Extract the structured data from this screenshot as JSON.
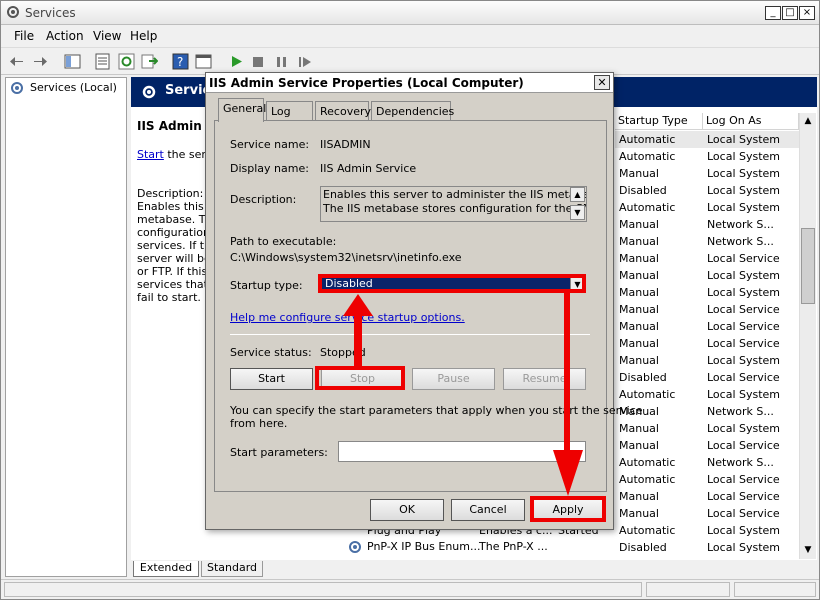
{
  "window": {
    "title": "Services"
  },
  "menu": [
    "File",
    "Action",
    "View",
    "Help"
  ],
  "tree": {
    "root": "Services (Local)"
  },
  "panel": {
    "header": "Service",
    "service_title": "IIS Admin Se",
    "start_link": "Start",
    "start_rest": " the servi",
    "description_label": "Description:",
    "description_lines": [
      "Enables this se",
      "metabase. The",
      "configuration f",
      "services. If thi",
      "server will be u",
      "or FTP. If this",
      "services that e",
      "fail to start."
    ]
  },
  "list": {
    "columns": [
      "Startup Type",
      "Log On As"
    ],
    "rows": [
      [
        "Automatic",
        "Local System"
      ],
      [
        "Automatic",
        "Local System"
      ],
      [
        "Manual",
        "Local System"
      ],
      [
        "Disabled",
        "Local System"
      ],
      [
        "Automatic",
        "Local System"
      ],
      [
        "Manual",
        "Network S..."
      ],
      [
        "Manual",
        "Network S..."
      ],
      [
        "Manual",
        "Local Service"
      ],
      [
        "Manual",
        "Local System"
      ],
      [
        "Manual",
        "Local System"
      ],
      [
        "Manual",
        "Local Service"
      ],
      [
        "Manual",
        "Local Service"
      ],
      [
        "Manual",
        "Local Service"
      ],
      [
        "Manual",
        "Local System"
      ],
      [
        "Disabled",
        "Local Service"
      ],
      [
        "Automatic",
        "Local System"
      ],
      [
        "Manual",
        "Network S..."
      ],
      [
        "Manual",
        "Local System"
      ],
      [
        "Manual",
        "Local Service"
      ],
      [
        "Automatic",
        "Network S..."
      ],
      [
        "Automatic",
        "Local Service"
      ],
      [
        "Manual",
        "Local Service"
      ],
      [
        "Manual",
        "Local Service"
      ],
      [
        "Automatic",
        "Local System"
      ],
      [
        "Disabled",
        "Local System"
      ]
    ],
    "partial_row": {
      "name": "Plug and Play",
      "desc": "Enables a c...",
      "status": "Started"
    },
    "last_row": {
      "name": "PnP-X IP Bus Enum...",
      "desc": "The PnP-X ..."
    }
  },
  "bottom_tabs": [
    "Extended",
    "Standard"
  ],
  "dialog": {
    "title": "IIS Admin Service Properties (Local Computer)",
    "tabs": [
      "General",
      "Log On",
      "Recovery",
      "Dependencies"
    ],
    "service_name_label": "Service name:",
    "service_name": "IISADMIN",
    "display_name_label": "Display name:",
    "display_name": "IIS Admin Service",
    "description_label": "Description:",
    "description_line1": "Enables this server to administer the IIS metabase.",
    "description_line2": "The IIS metabase stores configuration for the SMTP",
    "path_label": "Path to executable:",
    "path": "C:\\Windows\\system32\\inetsrv\\inetinfo.exe",
    "startup_type_label": "Startup type:",
    "startup_type": "Disabled",
    "help_link": "Help me configure service startup options.",
    "status_label": "Service status:",
    "status": "Stopped",
    "btn_start": "Start",
    "btn_stop": "Stop",
    "btn_pause": "Pause",
    "btn_resume": "Resume",
    "params_note_line1": "You can specify the start parameters that apply when you start the service",
    "params_note_line2": "from here.",
    "params_label": "Start parameters:",
    "params_value": "",
    "btn_ok": "OK",
    "btn_cancel": "Cancel",
    "btn_apply": "Apply"
  },
  "colors": {
    "header": "#002366",
    "selection": "#0a246a",
    "annotation": "#ee0000",
    "link": "#0000cc"
  }
}
